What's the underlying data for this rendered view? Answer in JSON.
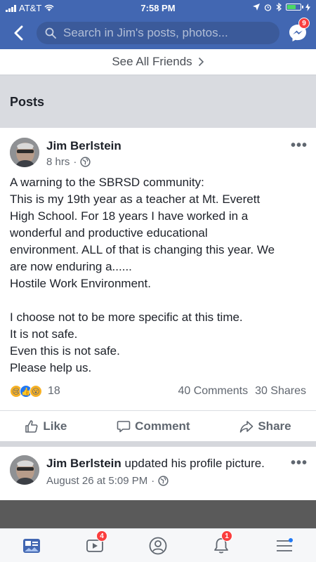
{
  "status_bar": {
    "carrier": "AT&T",
    "time": "7:58 PM"
  },
  "header": {
    "search_placeholder": "Search in Jim's posts, photos...",
    "messenger_badge": "9",
    "accent_color": "#4267b2"
  },
  "friends": {
    "see_all_label": "See All Friends"
  },
  "posts_section": {
    "title": "Posts"
  },
  "post1": {
    "author": "Jim Berlstein",
    "time": "8 hrs",
    "privacy_icon": "globe-icon",
    "text_lines": [
      "A warning to the SBRSD community:",
      "This is my 19th year as a teacher at Mt. Everett",
      "High School. For 18 years I have worked in a",
      "wonderful and productive educational",
      "environment. ALL of that is changing this year. We",
      "are now enduring a......",
      "Hostile Work Environment.",
      "",
      "I choose not to be more specific at this time.",
      "It is not safe.",
      "Even this is not safe.",
      "Please help us."
    ],
    "reaction_count": "18",
    "comments": "40 Comments",
    "shares": "30 Shares",
    "actions": {
      "like": "Like",
      "comment": "Comment",
      "share": "Share"
    }
  },
  "post2": {
    "author": "Jim Berlstein",
    "activity": "updated his profile picture.",
    "time": "August 26 at 5:09 PM"
  },
  "tabbar": {
    "video_badge": "4",
    "notifications_badge": "1"
  }
}
